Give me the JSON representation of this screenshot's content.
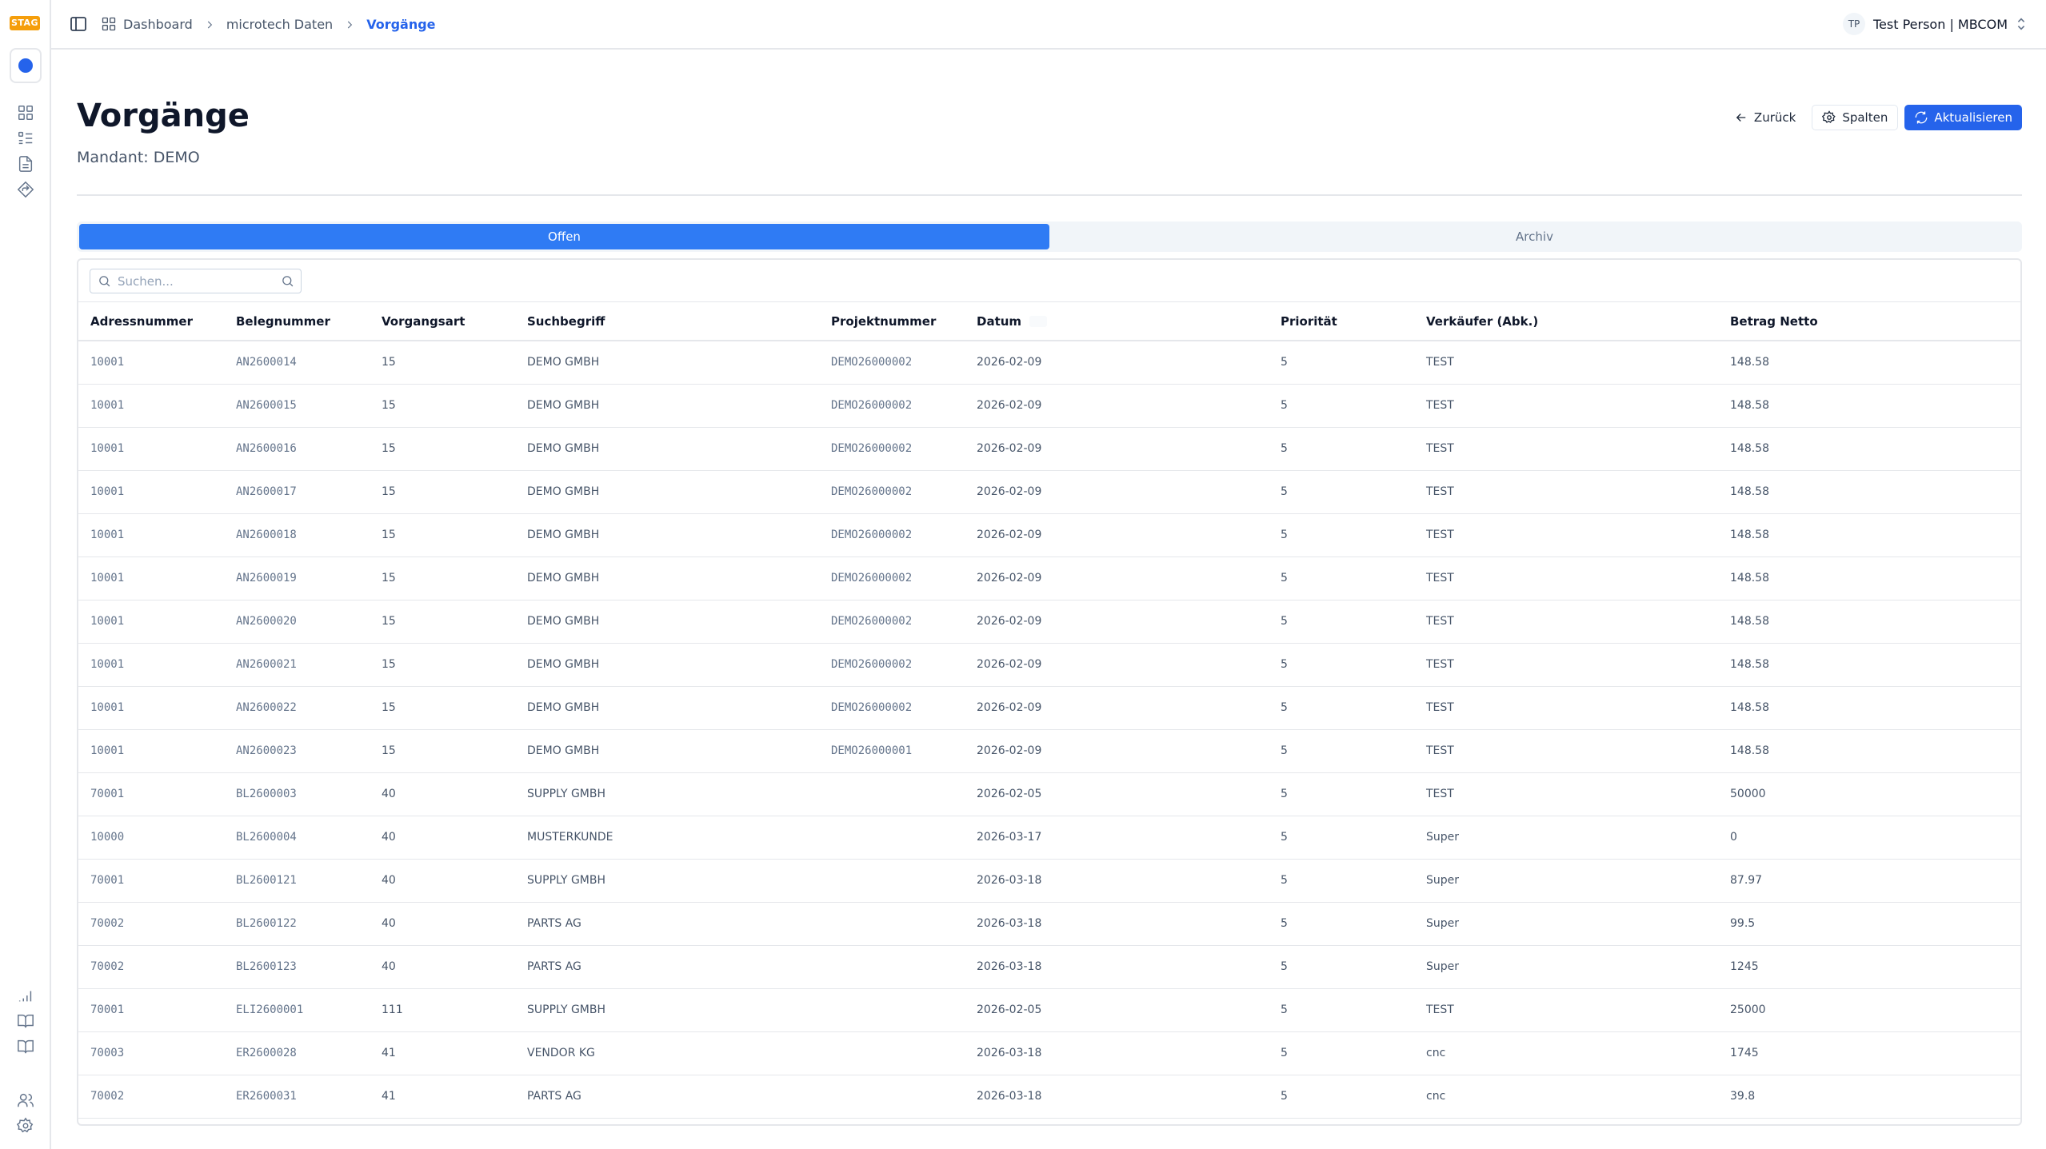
{
  "env_badge": "STAG",
  "breadcrumb": [
    {
      "label": "Dashboard"
    },
    {
      "label": "microtech Daten"
    },
    {
      "label": "Vorgänge"
    }
  ],
  "user": {
    "initials": "TP",
    "name": "Test Person | MBCOM"
  },
  "page": {
    "title": "Vorgänge",
    "subtitle": "Mandant: DEMO"
  },
  "actions": {
    "back": "Zurück",
    "columns": "Spalten",
    "refresh": "Aktualisieren"
  },
  "tabs": [
    {
      "label": "Offen",
      "active": true
    },
    {
      "label": "Archiv",
      "active": false
    }
  ],
  "search": {
    "placeholder": "Suchen...",
    "value": ""
  },
  "table": {
    "columns": [
      "Adressnummer",
      "Belegnummer",
      "Vorgangsart",
      "Suchbegriff",
      "Projektnummer",
      "Datum",
      "Priorität",
      "Verkäufer (Abk.)",
      "Betrag Netto"
    ],
    "rows": [
      [
        "10001",
        "AN2600014",
        "15",
        "DEMO GMBH",
        "DEMO26000002",
        "2026-02-09",
        "5",
        "TEST",
        "148.58"
      ],
      [
        "10001",
        "AN2600015",
        "15",
        "DEMO GMBH",
        "DEMO26000002",
        "2026-02-09",
        "5",
        "TEST",
        "148.58"
      ],
      [
        "10001",
        "AN2600016",
        "15",
        "DEMO GMBH",
        "DEMO26000002",
        "2026-02-09",
        "5",
        "TEST",
        "148.58"
      ],
      [
        "10001",
        "AN2600017",
        "15",
        "DEMO GMBH",
        "DEMO26000002",
        "2026-02-09",
        "5",
        "TEST",
        "148.58"
      ],
      [
        "10001",
        "AN2600018",
        "15",
        "DEMO GMBH",
        "DEMO26000002",
        "2026-02-09",
        "5",
        "TEST",
        "148.58"
      ],
      [
        "10001",
        "AN2600019",
        "15",
        "DEMO GMBH",
        "DEMO26000002",
        "2026-02-09",
        "5",
        "TEST",
        "148.58"
      ],
      [
        "10001",
        "AN2600020",
        "15",
        "DEMO GMBH",
        "DEMO26000002",
        "2026-02-09",
        "5",
        "TEST",
        "148.58"
      ],
      [
        "10001",
        "AN2600021",
        "15",
        "DEMO GMBH",
        "DEMO26000002",
        "2026-02-09",
        "5",
        "TEST",
        "148.58"
      ],
      [
        "10001",
        "AN2600022",
        "15",
        "DEMO GMBH",
        "DEMO26000002",
        "2026-02-09",
        "5",
        "TEST",
        "148.58"
      ],
      [
        "10001",
        "AN2600023",
        "15",
        "DEMO GMBH",
        "DEMO26000001",
        "2026-02-09",
        "5",
        "TEST",
        "148.58"
      ],
      [
        "70001",
        "BL2600003",
        "40",
        "SUPPLY GMBH",
        "",
        "2026-02-05",
        "5",
        "TEST",
        "50000"
      ],
      [
        "10000",
        "BL2600004",
        "40",
        "MUSTERKUNDE",
        "",
        "2026-03-17",
        "5",
        "Super",
        "0"
      ],
      [
        "70001",
        "BL2600121",
        "40",
        "SUPPLY GMBH",
        "",
        "2026-03-18",
        "5",
        "Super",
        "87.97"
      ],
      [
        "70002",
        "BL2600122",
        "40",
        "PARTS AG",
        "",
        "2026-03-18",
        "5",
        "Super",
        "99.5"
      ],
      [
        "70002",
        "BL2600123",
        "40",
        "PARTS AG",
        "",
        "2026-03-18",
        "5",
        "Super",
        "1245"
      ],
      [
        "70001",
        "ELI2600001",
        "111",
        "SUPPLY GMBH",
        "",
        "2026-02-05",
        "5",
        "TEST",
        "25000"
      ],
      [
        "70003",
        "ER2600028",
        "41",
        "VENDOR KG",
        "",
        "2026-03-18",
        "5",
        "cnc",
        "1745"
      ],
      [
        "70002",
        "ER2600031",
        "41",
        "PARTS AG",
        "",
        "2026-03-18",
        "5",
        "cnc",
        "39.8"
      ]
    ]
  },
  "icons": {
    "rail_top": [
      "dashboard-grid-icon",
      "list-checks-icon",
      "document-icon",
      "routing-icon"
    ],
    "rail_bottom": [
      "signal-bars-icon",
      "book-open-icon",
      "book-icon",
      "users-icon",
      "settings-gear-icon"
    ]
  },
  "colors": {
    "accent": "#2563eb",
    "badge": "#f59e0b",
    "tab_active": "#2f7bf4"
  }
}
